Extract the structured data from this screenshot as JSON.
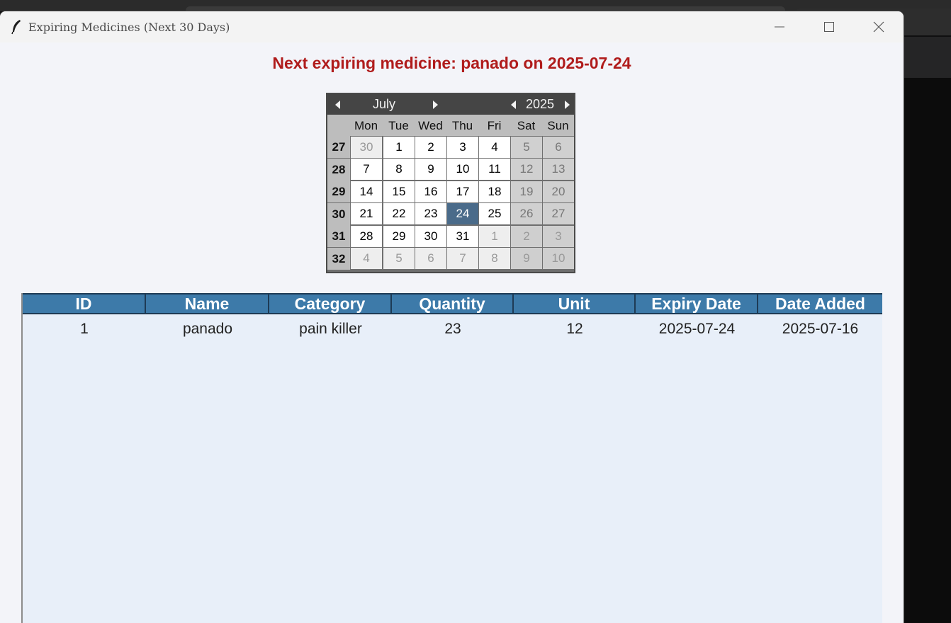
{
  "window": {
    "title": "Expiring Medicines (Next 30 Days)"
  },
  "headline": "Next expiring medicine: panado on 2025-07-24",
  "calendar": {
    "month": "July",
    "year": "2025",
    "weekdays": [
      "Mon",
      "Tue",
      "Wed",
      "Thu",
      "Fri",
      "Sat",
      "Sun"
    ],
    "weeks": [
      {
        "num": "27",
        "days": [
          "30",
          "1",
          "2",
          "3",
          "4",
          "5",
          "6"
        ]
      },
      {
        "num": "28",
        "days": [
          "7",
          "8",
          "9",
          "10",
          "11",
          "12",
          "13"
        ]
      },
      {
        "num": "29",
        "days": [
          "14",
          "15",
          "16",
          "17",
          "18",
          "19",
          "20"
        ]
      },
      {
        "num": "30",
        "days": [
          "21",
          "22",
          "23",
          "24",
          "25",
          "26",
          "27"
        ]
      },
      {
        "num": "31",
        "days": [
          "28",
          "29",
          "30",
          "31",
          "1",
          "2",
          "3"
        ]
      },
      {
        "num": "32",
        "days": [
          "4",
          "5",
          "6",
          "7",
          "8",
          "9",
          "10"
        ]
      }
    ],
    "selected_day": "24"
  },
  "table": {
    "columns": [
      "ID",
      "Name",
      "Category",
      "Quantity",
      "Unit",
      "Expiry Date",
      "Date Added"
    ],
    "rows": [
      [
        "1",
        "panado",
        "pain killer",
        "23",
        "12",
        "2025-07-24",
        "2025-07-16"
      ]
    ]
  },
  "colors": {
    "headline": "#b01c1c",
    "table_header": "#3d7aa9",
    "table_body": "#e8eff9",
    "calendar_selected": "#4a6b8a"
  }
}
